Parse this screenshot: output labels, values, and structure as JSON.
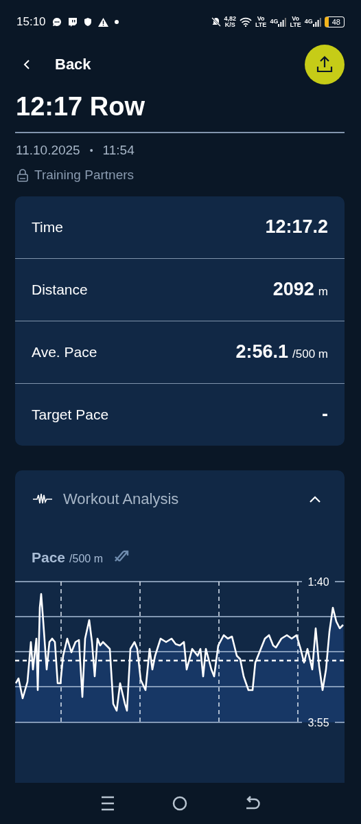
{
  "status_bar": {
    "time": "15:10",
    "speed_value": "4,82",
    "speed_unit": "K/S",
    "network_labels": [
      {
        "top": "Vo",
        "bottom": "LTE",
        "tech": "4G"
      },
      {
        "top": "Vo",
        "bottom": "LTE",
        "tech": "4G"
      }
    ],
    "battery": "48"
  },
  "header": {
    "back_label": "Back",
    "title": "12:17 Row"
  },
  "meta": {
    "date": "11.10.2025",
    "separator": "•",
    "time": "11:54",
    "visibility": "Training Partners"
  },
  "metrics": [
    {
      "label": "Time",
      "value": "12:17.2"
    },
    {
      "label": "Distance",
      "value": "2092",
      "unit": "m"
    },
    {
      "label": "Ave. Pace",
      "value": "2:56.1",
      "unit": "/500 m"
    },
    {
      "label": "Target Pace",
      "value": "-"
    }
  ],
  "analysis": {
    "title": "Workout Analysis",
    "expanded": true,
    "chart": {
      "title": "Pace",
      "unit": "/500 m",
      "top_label": "1:40",
      "bottom_label": "3:55"
    }
  }
}
